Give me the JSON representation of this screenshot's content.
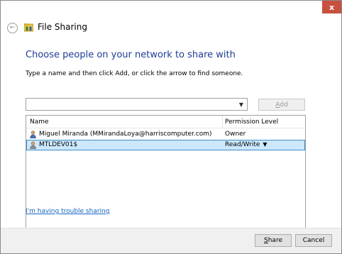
{
  "window": {
    "title": "File Sharing",
    "close_glyph": "x"
  },
  "main": {
    "heading": "Choose people on your network to share with",
    "instruction": "Type a name and then click Add, or click the arrow to find someone.",
    "name_input": {
      "value": "",
      "placeholder": ""
    },
    "add_button": {
      "mnemonic": "A",
      "rest": "dd"
    },
    "list": {
      "columns": {
        "name": "Name",
        "permission": "Permission Level"
      },
      "rows": [
        {
          "name": "Miguel Miranda (MMirandaLoya@harriscomputer.com)",
          "permission": "Owner"
        },
        {
          "name": "MTLDEV01$",
          "permission": "Read/Write"
        }
      ]
    },
    "trouble_link": "I'm having trouble sharing"
  },
  "footer": {
    "share_button": {
      "mnemonic": "S",
      "rest": "hare"
    },
    "cancel_button": "Cancel"
  },
  "colors": {
    "heading": "#1e3c96",
    "link": "#1565c0",
    "selection_bg": "#cce8ff",
    "selection_border": "#3f8cc6",
    "close_button": "#c7503f"
  },
  "icons": {
    "back": "back-arrow-icon",
    "app": "file-sharing-icon",
    "user": "user-icon",
    "dropdown": "chevron-down-icon"
  }
}
